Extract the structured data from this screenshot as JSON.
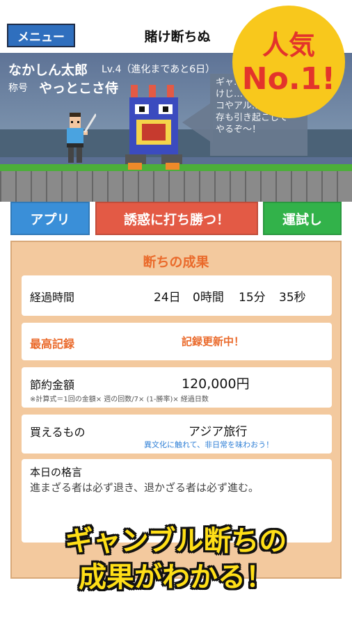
{
  "header": {
    "menu_label": "メニュー",
    "title": "賭け断ちぬ"
  },
  "badge": {
    "line1": "人気",
    "line2": "No.1!"
  },
  "player": {
    "name": "なかしん太郎",
    "level": "Lv.4（進化まであと6日）",
    "title_label": "称号",
    "title_value": "やっとこさ侍"
  },
  "speech": {
    "text": "ギャ…\nけじ…\nコやアル…\n存も引き起こして\nやるぞ〜！"
  },
  "buttons": {
    "app": "アプリ",
    "resist": "誘惑に打ち勝つ！",
    "luck": "運試し"
  },
  "result": {
    "title": "断ちの成果",
    "elapsed": {
      "label": "経過時間",
      "days": "24日",
      "hours": "0時間",
      "minutes": "15分",
      "seconds": "35秒"
    },
    "best": {
      "label": "最高記録",
      "value": "記録更新中！"
    },
    "saved": {
      "label": "節約金額",
      "value": "120,000円",
      "note": "※計算式＝1回の金額× 週の回数/7× (1-勝率)× 経過日数"
    },
    "buy": {
      "label": "買えるもの",
      "value": "アジア旅行",
      "note": "異文化に触れて、非日常を味わおう！"
    },
    "quote": {
      "label": "本日の格言",
      "value": "進まざる者は必ず退き、退かざる者は必ず進む。"
    }
  },
  "caption": {
    "line1": "ギャンブル断ちの",
    "line2": "成果がわかる！"
  },
  "colors": {
    "menu": "#2f6fbe",
    "app_button": "#3a8fd8",
    "resist_button": "#e35a45",
    "luck_button": "#32b24a",
    "panel": "#f3c99e",
    "accent": "#ea6a2b",
    "badge": "#f8c81c",
    "caption": "#ffdf17"
  }
}
